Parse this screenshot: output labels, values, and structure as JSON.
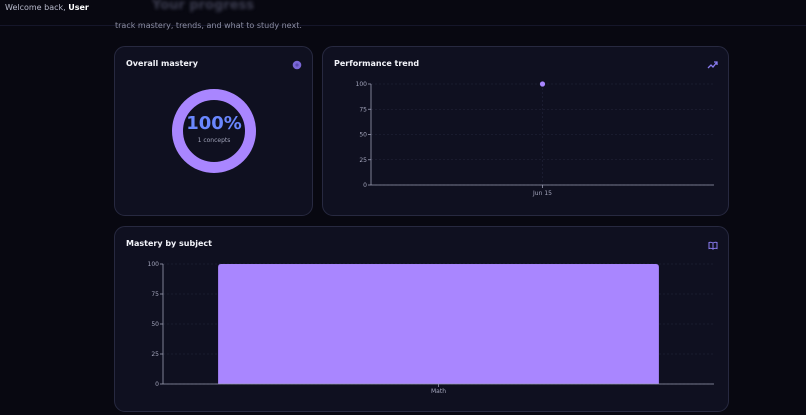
{
  "header": {
    "welcome_prefix": "Welcome back,",
    "username": "User",
    "page_title": "Your progress",
    "subtitle": "track mastery, trends, and what to study next."
  },
  "overall": {
    "title": "Overall mastery",
    "value": "100%",
    "sub": "1 concepts",
    "mastery_fraction": 1.0,
    "icon": "circle-dot-icon"
  },
  "trend": {
    "title": "Performance trend",
    "icon": "trending-up-icon"
  },
  "subject": {
    "title": "Mastery by subject",
    "icon": "book-open-icon"
  },
  "colors": {
    "accent": "#a986ff",
    "accent_text": "#6a87ff",
    "card_bg": "#0f1020",
    "page_bg": "#080811"
  },
  "chart_data": [
    {
      "type": "scatter",
      "x": [
        "Jun 15"
      ],
      "y": [
        100
      ],
      "ylim": [
        0,
        100
      ],
      "yticks": [
        0,
        25,
        50,
        75,
        100
      ],
      "grid": true
    },
    {
      "type": "bar",
      "categories": [
        "Math"
      ],
      "values": [
        100
      ],
      "ylim": [
        0,
        100
      ],
      "yticks": [
        0,
        25,
        50,
        75,
        100
      ],
      "grid": true
    }
  ]
}
